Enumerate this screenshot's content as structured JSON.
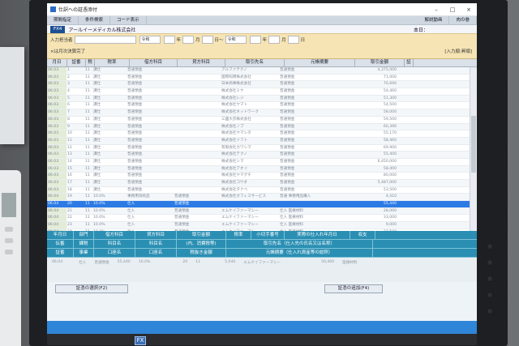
{
  "window": {
    "title": "仕訳への証憑添付",
    "controls": {
      "min": "–",
      "max": "□",
      "close": "×"
    }
  },
  "menu": {
    "items": [
      "期間指定",
      "条件検索",
      "コード表示",
      "解説動画",
      "肉の巻"
    ],
    "date_label": "本日："
  },
  "company": {
    "badge": "FX4",
    "name": "アールイーメディカル株式会社"
  },
  "filter": {
    "operator_label": "入力担当者",
    "period_label": "×は月次決算完了",
    "era_from": "令和",
    "era_to": "令和",
    "year_unit": "年",
    "month_unit": "月",
    "day_unit": "日",
    "tilde": "～",
    "order_label": "[入力順:昇順]"
  },
  "table": {
    "columns": [
      "月日",
      "証番",
      "税",
      "税率",
      "借方科目",
      "貸方科目",
      "取引先名",
      "元帳摘要",
      "取引金額",
      "証"
    ],
    "rows": [
      [
        "06.03",
        "1",
        "11",
        "課仕",
        "普通預金",
        "",
        "アルファテクノ",
        "普通預金",
        "4,375,000"
      ],
      [
        "06.03",
        "2",
        "11",
        "課仕",
        "普通預金",
        "",
        "国際照明株式会社",
        "普通預金",
        "71,000"
      ],
      [
        "06.03",
        "3",
        "11",
        "課仕",
        "普通預金",
        "",
        "日本商事株式会社",
        "普通預金",
        "76,690"
      ],
      [
        "06.03",
        "4",
        "11",
        "課仕",
        "普通預金",
        "",
        "株式会社ミヤ",
        "普通預金",
        "54,460"
      ],
      [
        "06.03",
        "5",
        "11",
        "課仕",
        "普通預金",
        "",
        "株式会社レジ",
        "普通預金",
        "51,300"
      ],
      [
        "06.03",
        "6",
        "11",
        "課仕",
        "普通預金",
        "",
        "株式会社ヤマト",
        "普通預金",
        "54,500"
      ],
      [
        "06.03",
        "7",
        "11",
        "課仕",
        "普通預金",
        "",
        "株式会社ネットワーク",
        "普通預金",
        "58,000"
      ],
      [
        "06.03",
        "8",
        "11",
        "課仕",
        "普通預金",
        "",
        "三國大京株式会社",
        "普通預金",
        "59,500"
      ],
      [
        "06.03",
        "9",
        "11",
        "課仕",
        "普通預金",
        "",
        "株式会社ノブ",
        "普通預金",
        "60,390"
      ],
      [
        "06.03",
        "10",
        "11",
        "課仕",
        "普通預金",
        "",
        "株式会社ヤマシタ",
        "普通預金",
        "55,170"
      ],
      [
        "06.03",
        "11",
        "11",
        "課仕",
        "普通預金",
        "",
        "株式会社ソフト",
        "普通預金",
        "58,460"
      ],
      [
        "06.03",
        "12",
        "11",
        "課仕",
        "普通預金",
        "",
        "有限会社カワシマ",
        "普通預金",
        "69,900"
      ],
      [
        "06.03",
        "13",
        "11",
        "課仕",
        "普通預金",
        "",
        "株式会社テクノ",
        "普通預金",
        "55,400"
      ],
      [
        "06.03",
        "14",
        "11",
        "課仕",
        "普通預金",
        "",
        "株式会社シマ",
        "普通預金",
        "6,450,000"
      ],
      [
        "06.03",
        "15",
        "11",
        "課仕",
        "普通預金",
        "",
        "株式会社アオイ",
        "普通預金",
        "58,400"
      ],
      [
        "06.03",
        "16",
        "11",
        "課仕",
        "普通預金",
        "",
        "株式会社ヤマグチ",
        "普通預金",
        "80,000"
      ],
      [
        "06.03",
        "17",
        "11",
        "課仕",
        "普通預金",
        "",
        "株式会社コウダ",
        "普通預金",
        "5,487,000"
      ],
      [
        "06.03",
        "18",
        "11",
        "課仕",
        "普通預金",
        "",
        "株式会社タナベ",
        "普通預金",
        "53,500"
      ],
      [
        "06.04",
        "19",
        "11",
        "10.0%",
        "事務用消耗品",
        "普通預金",
        "株式会社オフィスサービス",
        "普通 事務用品購入",
        "4,410"
      ],
      [
        "06.04",
        "20",
        "11",
        "10.0%",
        "仕入",
        "普通預金",
        "",
        "",
        "55,440"
      ],
      [
        "06.04",
        "21",
        "11",
        "10.0%",
        "仕入",
        "普通預金",
        "エムケイファーマシー",
        "仕入 医療材料",
        "28,000"
      ],
      [
        "06.04",
        "22",
        "11",
        "10.0%",
        "仕入",
        "普通預金",
        "エムケイファーマシー",
        "仕入 医療材料",
        "33,000"
      ],
      [
        "06.04",
        "23",
        "11",
        "10.0%",
        "仕入",
        "普通預金",
        "エムケイファーマシー",
        "仕入 医療材料",
        "9,000"
      ],
      [
        "06.04",
        "24",
        "11",
        "10.0%",
        "仕入",
        "普通預金",
        "エムケイファーマシー",
        "仕入 医療材料",
        "27,500"
      ]
    ],
    "selected_index": 19
  },
  "detail": {
    "row1": [
      "年月日",
      "部門",
      "借方科目",
      "貸方科目",
      "取引金額",
      "税率",
      "小切手番号",
      "実際の仕入れ年月日",
      "収支"
    ],
    "row2": [
      "伝番",
      "課税",
      "科目名",
      "科目名",
      "(内、消費税等)",
      "取引先名（仕入先の氏名又は名称）"
    ],
    "row3": [
      "証番",
      "事業",
      "口座名",
      "口座名",
      "税抜き金額",
      "元帳摘要（仕入れ資産等の総称）"
    ],
    "values": [
      "06.04",
      "",
      "仕入",
      "普通預金",
      "55,440",
      "10.0%",
      "",
      "",
      "",
      "20",
      "11",
      "",
      "",
      "5,040",
      "エムケイファーマシー",
      "",
      "",
      "",
      "",
      "50,400",
      "医療材料"
    ]
  },
  "buttons": {
    "select_evidence": "証憑の選択(F2)",
    "add_evidence": "証憑の追加(F4)"
  },
  "taskbar": {
    "icon": "FX"
  }
}
